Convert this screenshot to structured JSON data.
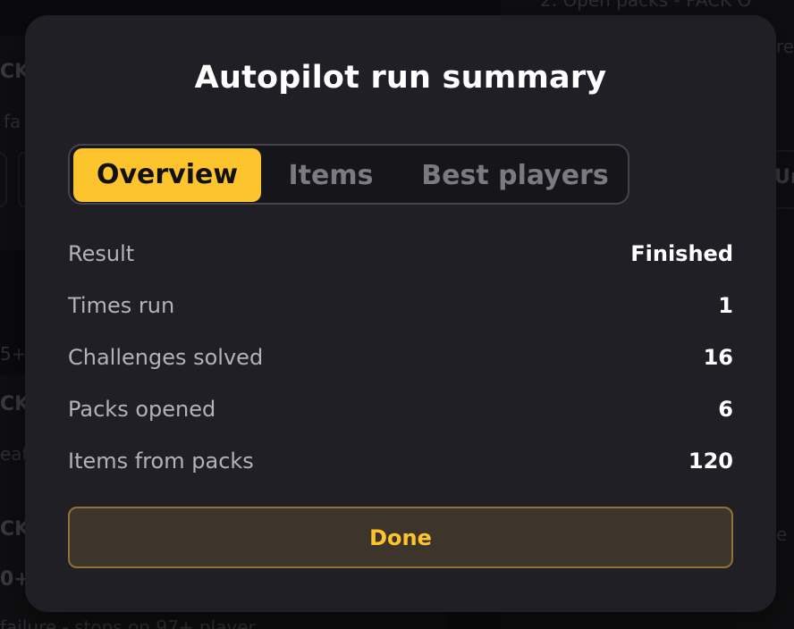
{
  "background": {
    "texts": [
      "CK",
      "fa",
      "5+",
      "CK",
      "eat",
      "CK",
      "0+",
      "failure - stops on 97+ player",
      "2. Open packs - PACK O",
      "re",
      "Ur",
      "e"
    ]
  },
  "modal": {
    "title": "Autopilot run summary",
    "tabs": [
      {
        "label": "Overview",
        "active": true
      },
      {
        "label": "Items",
        "active": false
      },
      {
        "label": "Best players",
        "active": false
      }
    ],
    "stats": [
      {
        "label": "Result",
        "value": "Finished"
      },
      {
        "label": "Times run",
        "value": "1"
      },
      {
        "label": "Challenges solved",
        "value": "16"
      },
      {
        "label": "Packs opened",
        "value": "6"
      },
      {
        "label": "Items from packs",
        "value": "120"
      }
    ],
    "done_label": "Done"
  },
  "colors": {
    "accent": "#fec42e",
    "modal_bg": "#201f26",
    "done_bg": "#3d342b"
  }
}
